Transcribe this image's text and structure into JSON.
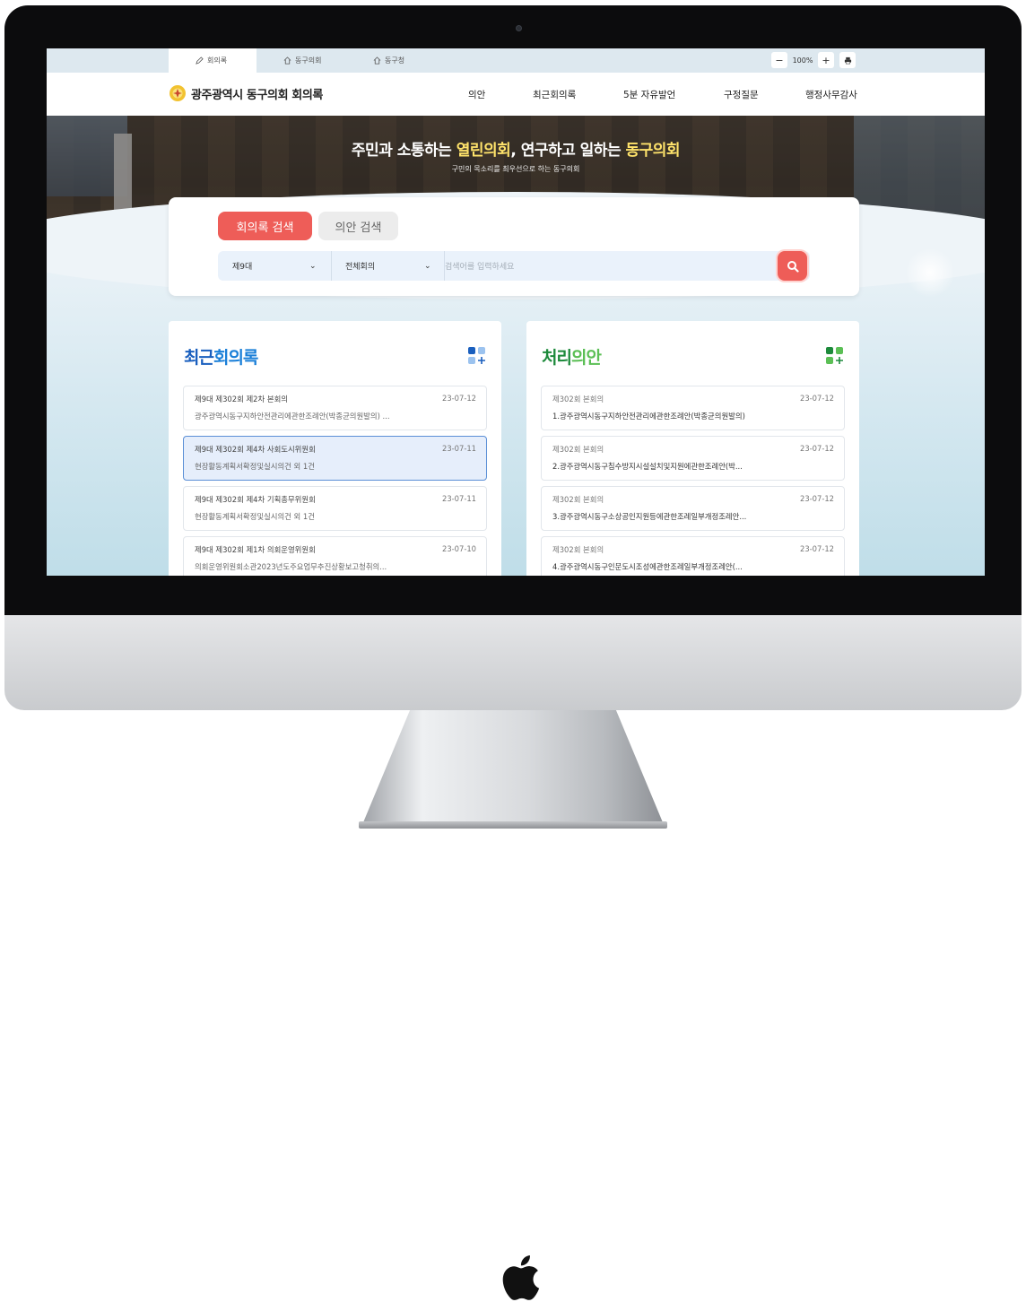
{
  "topbar": {
    "tabs": [
      {
        "label": "회의록",
        "icon": "pencil-icon"
      },
      {
        "label": "동구의회",
        "icon": "home-icon"
      },
      {
        "label": "동구청",
        "icon": "home-icon"
      }
    ],
    "zoom_minus": "−",
    "zoom_value": "100%",
    "zoom_plus": "+",
    "print_icon": "print-icon"
  },
  "header": {
    "logo_text": "광주광역시 동구의회 회의록",
    "nav": [
      "의안",
      "최근회의록",
      "5분 자유발언",
      "구정질문",
      "행정사무감사"
    ]
  },
  "hero": {
    "title_pre": "주민과 소통하는 ",
    "title_hl1": "열린의회",
    "title_mid": ", 연구하고 일하는 ",
    "title_hl2": "동구의회",
    "subtitle": "구민의 목소리를 최우선으로 하는 동구의회"
  },
  "search": {
    "tab_active": "회의록 검색",
    "tab_inactive": "의안 검색",
    "select_term": "제9대",
    "select_meeting": "전체회의",
    "placeholder": "검색어를 입력하세요"
  },
  "recent": {
    "title_a": "최근",
    "title_b": "회의록",
    "items": [
      {
        "title": "제9대 제302회 제2차 본회의",
        "date": "23-07-12",
        "desc": "광주광역시동구지하안전관리에관한조례안(박종균의원발의) ..."
      },
      {
        "title": "제9대 제302회 제4차 사회도시위원회",
        "date": "23-07-11",
        "desc": "현장활동계획서확정및실시의건 외 1건"
      },
      {
        "title": "제9대 제302회 제4차 기획총무위원회",
        "date": "23-07-11",
        "desc": "현장활동계획서확정및실시의건 외 1건"
      },
      {
        "title": "제9대 제302회 제1차 의회운영위원회",
        "date": "23-07-10",
        "desc": "의회운영위원회소관2023년도주요업무추진상황보고청취의..."
      }
    ]
  },
  "bills": {
    "title_a": "처리",
    "title_b": "의안",
    "items": [
      {
        "title": "제302회 본회의",
        "date": "23-07-12",
        "desc": "1.광주광역시동구지하안전관리에관한조례안(박종균의원발의)"
      },
      {
        "title": "제302회 본회의",
        "date": "23-07-12",
        "desc": "2.광주광역시동구침수방지시설설치및지원에관한조례안(박..."
      },
      {
        "title": "제302회 본회의",
        "date": "23-07-12",
        "desc": "3.광주광역시동구소상공인지원등에관한조례일부개정조례안..."
      },
      {
        "title": "제302회 본회의",
        "date": "23-07-12",
        "desc": "4.광주광역시동구인문도시조성에관한조례일부개정조례안(..."
      }
    ]
  },
  "colors": {
    "accent": "#ee5d58",
    "recent_title": "#1a5fbe",
    "bills_title": "#1d8a3b",
    "highlight": "#ffe36b"
  }
}
